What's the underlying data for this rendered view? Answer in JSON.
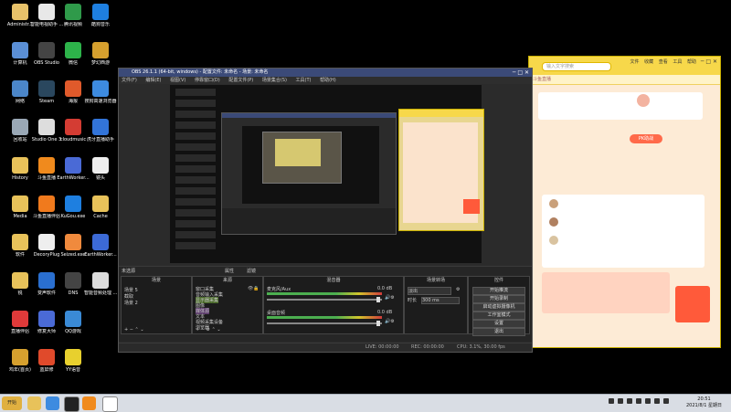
{
  "desktop_icons": [
    {
      "label": "Administr...",
      "col": 0,
      "row": 0,
      "color": "#e8c26a"
    },
    {
      "label": "智能电视助手 ...",
      "col": 1,
      "row": 0,
      "color": "#e8e8e8"
    },
    {
      "label": "腾讯视频",
      "col": 2,
      "row": 0,
      "color": "#2f9a4a"
    },
    {
      "label": "酷狗音乐",
      "col": 3,
      "row": 0,
      "color": "#1e7fe0"
    },
    {
      "label": "计算机",
      "col": 0,
      "row": 1,
      "color": "#5a8fd6"
    },
    {
      "label": "OBS Studio",
      "col": 1,
      "row": 1,
      "color": "#444"
    },
    {
      "label": "微信",
      "col": 2,
      "row": 1,
      "color": "#2db34a"
    },
    {
      "label": "梦幻西游",
      "col": 3,
      "row": 1,
      "color": "#d6a02e"
    },
    {
      "label": "网络",
      "col": 0,
      "row": 2,
      "color": "#4b86c9"
    },
    {
      "label": "Steam",
      "col": 1,
      "row": 2,
      "color": "#2a475e"
    },
    {
      "label": "海报",
      "col": 2,
      "row": 2,
      "color": "#e05a2b"
    },
    {
      "label": "搜狗高速浏览器",
      "col": 3,
      "row": 2,
      "color": "#3d8be0"
    },
    {
      "label": "回收站",
      "col": 0,
      "row": 3,
      "color": "#9aa8b6"
    },
    {
      "label": "Studio One 3",
      "col": 1,
      "row": 3,
      "color": "#ddd"
    },
    {
      "label": "cloudmusic",
      "col": 2,
      "row": 3,
      "color": "#d43c33"
    },
    {
      "label": "虎牙直播助手",
      "col": 3,
      "row": 3,
      "color": "#3274d9"
    },
    {
      "label": "History",
      "col": 0,
      "row": 4,
      "color": "#e8c25a"
    },
    {
      "label": "斗鱼直播",
      "col": 1,
      "row": 4,
      "color": "#f08a1d"
    },
    {
      "label": "EarthWorker...",
      "col": 2,
      "row": 4,
      "color": "#4a6ad6"
    },
    {
      "label": "镜头",
      "col": 3,
      "row": 4,
      "color": "#eee"
    },
    {
      "label": "Media",
      "col": 0,
      "row": 5,
      "color": "#e8c25a"
    },
    {
      "label": "斗鱼直播伴侣",
      "col": 1,
      "row": 5,
      "color": "#f07a1d"
    },
    {
      "label": "KuGou.exe",
      "col": 2,
      "row": 5,
      "color": "#1e7fe0"
    },
    {
      "label": "Cache",
      "col": 3,
      "row": 5,
      "color": "#e8c25a"
    },
    {
      "label": "软件",
      "col": 0,
      "row": 6,
      "color": "#e8c25a"
    },
    {
      "label": "DecoryPlug",
      "col": 1,
      "row": 6,
      "color": "#eee"
    },
    {
      "label": "Seized.exe",
      "col": 2,
      "row": 6,
      "color": "#f08a3d"
    },
    {
      "label": "EarthWorker...",
      "col": 3,
      "row": 6,
      "color": "#3c6ad6"
    },
    {
      "label": "锐",
      "col": 0,
      "row": 7,
      "color": "#e8c25a"
    },
    {
      "label": "变声软件",
      "col": 1,
      "row": 7,
      "color": "#2a6fd0"
    },
    {
      "label": "DNS",
      "col": 2,
      "row": 7,
      "color": "#444"
    },
    {
      "label": "智能音频处理 ...",
      "col": 3,
      "row": 7,
      "color": "#ddd"
    },
    {
      "label": "直播伴侣",
      "col": 0,
      "row": 8,
      "color": "#e03a3a"
    },
    {
      "label": "修复大师",
      "col": 1,
      "row": 8,
      "color": "#4a6ad6"
    },
    {
      "label": "QQ游戏",
      "col": 2,
      "row": 8,
      "color": "#3a8ad6"
    },
    {
      "label": "鸡年(首页)",
      "col": 0,
      "row": 9,
      "color": "#d6a02e"
    },
    {
      "label": "蓝屏修",
      "col": 1,
      "row": 9,
      "color": "#e04a2b"
    },
    {
      "label": "YY语音",
      "col": 2,
      "row": 9,
      "color": "#e8d02e"
    }
  ],
  "browser": {
    "search_placeholder": "输入文字搜索",
    "menu": [
      "文件",
      "收藏",
      "查看",
      "工具",
      "帮助"
    ],
    "controls": "─ □ ✕",
    "nav_text": "斗鱼直播",
    "pk_button": "PK助战"
  },
  "obs": {
    "title": "OBS 26.1.1 (64-bit, windows) - 配置文件: 未命名 - 场景: 未命名",
    "controls": "─ □ ✕",
    "menu": [
      "文件(F)",
      "编辑(E)",
      "视图(V)",
      "停靠窗口(D)",
      "配置文件(P)",
      "场景集合(S)",
      "工具(T)",
      "帮助(H)"
    ],
    "source_bar_label": "未选源",
    "source_bar_buttons": [
      "属性",
      "滤镜"
    ],
    "panels": {
      "scenes": {
        "header": "场景",
        "items": [
          "场景 5",
          "截取",
          "场景 2"
        ]
      },
      "sources": {
        "header": "来源",
        "items": [
          "窗口采集",
          "音频输入采集",
          "显示器采集",
          "图像",
          "媒体源",
          "文本",
          "视频采集设备",
          "浏览器"
        ]
      },
      "mixer": {
        "header": "混音器",
        "channels": [
          {
            "name": "麦克风/Aux",
            "db": "0.0 dB"
          },
          {
            "name": "桌面音频",
            "db": "0.0 dB"
          }
        ]
      },
      "transitions": {
        "header": "场景转场",
        "type": "淡出",
        "duration_label": "时长",
        "duration": "300 ms"
      },
      "controls": {
        "header": "控件",
        "buttons": [
          "开始推流",
          "开始录制",
          "启动虚拟摄像机",
          "工作室模式",
          "设置",
          "退出"
        ]
      }
    },
    "status": {
      "live": "LIVE: 00:00:00",
      "rec": "REC: 00:00:00",
      "cpu": "CPU: 3.1%, 30.00 fps"
    }
  },
  "taskbar": {
    "start_label": "开始",
    "clock_time": "20:51",
    "clock_date": "2021/8/1 星期日"
  }
}
